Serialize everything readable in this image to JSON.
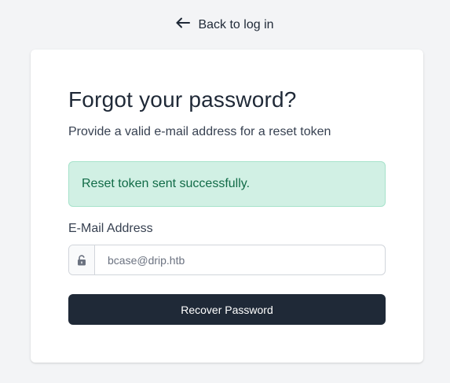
{
  "back_link": {
    "label": "Back to log in",
    "icon": "arrow-left-icon"
  },
  "card": {
    "title": "Forgot your password?",
    "subtitle": "Provide a valid e-mail address for a reset token",
    "alert": {
      "message": "Reset token sent successfully.",
      "color": "#116b47",
      "background": "#d1f0e4"
    },
    "email": {
      "label": "E-Mail Address",
      "value": "",
      "placeholder": "bcase@drip.htb",
      "icon": "unlock-icon"
    },
    "submit_label": "Recover Password"
  },
  "colors": {
    "primary": "#1f2937",
    "page_bg": "#f3f4f6"
  }
}
